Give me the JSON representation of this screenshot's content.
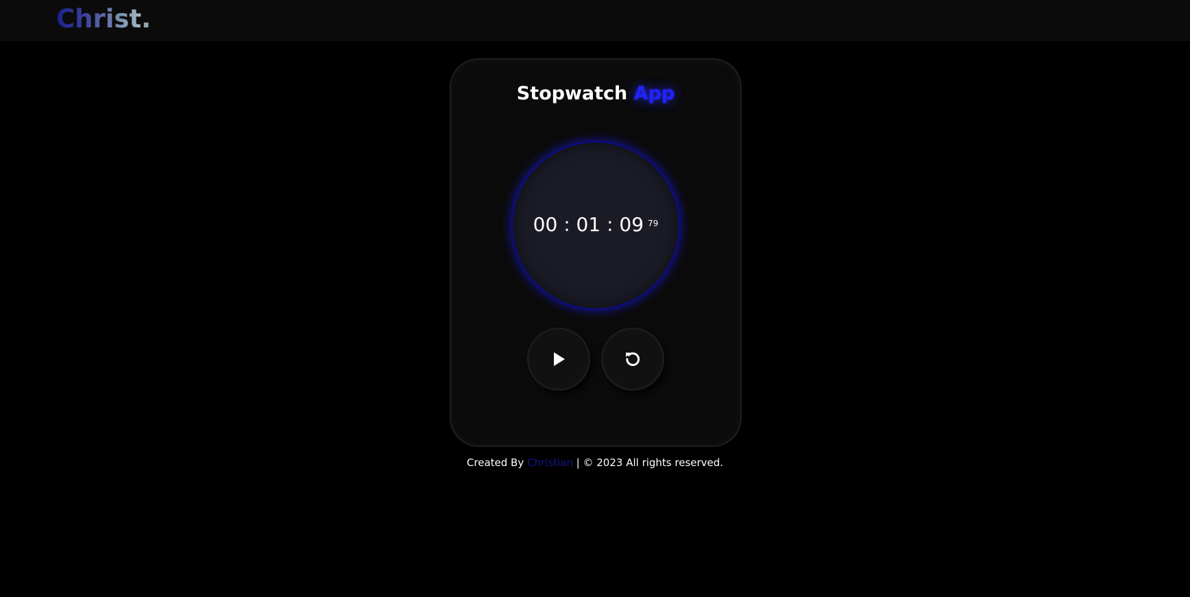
{
  "header": {
    "logo_main": "Christ",
    "logo_dot": "."
  },
  "card": {
    "title_main": "Stopwatch",
    "title_accent": "App"
  },
  "timer": {
    "display": "00 : 01 : 09",
    "milliseconds": "79"
  },
  "controls": {
    "play_icon": "play-icon",
    "reset_icon": "reset-icon"
  },
  "footer": {
    "prefix": "Created By",
    "author": "Christian",
    "suffix": "| © 2023 All rights reserved."
  },
  "colors": {
    "background": "#000000",
    "accent_blue": "#1f23ff",
    "author_blue": "#14148c"
  }
}
